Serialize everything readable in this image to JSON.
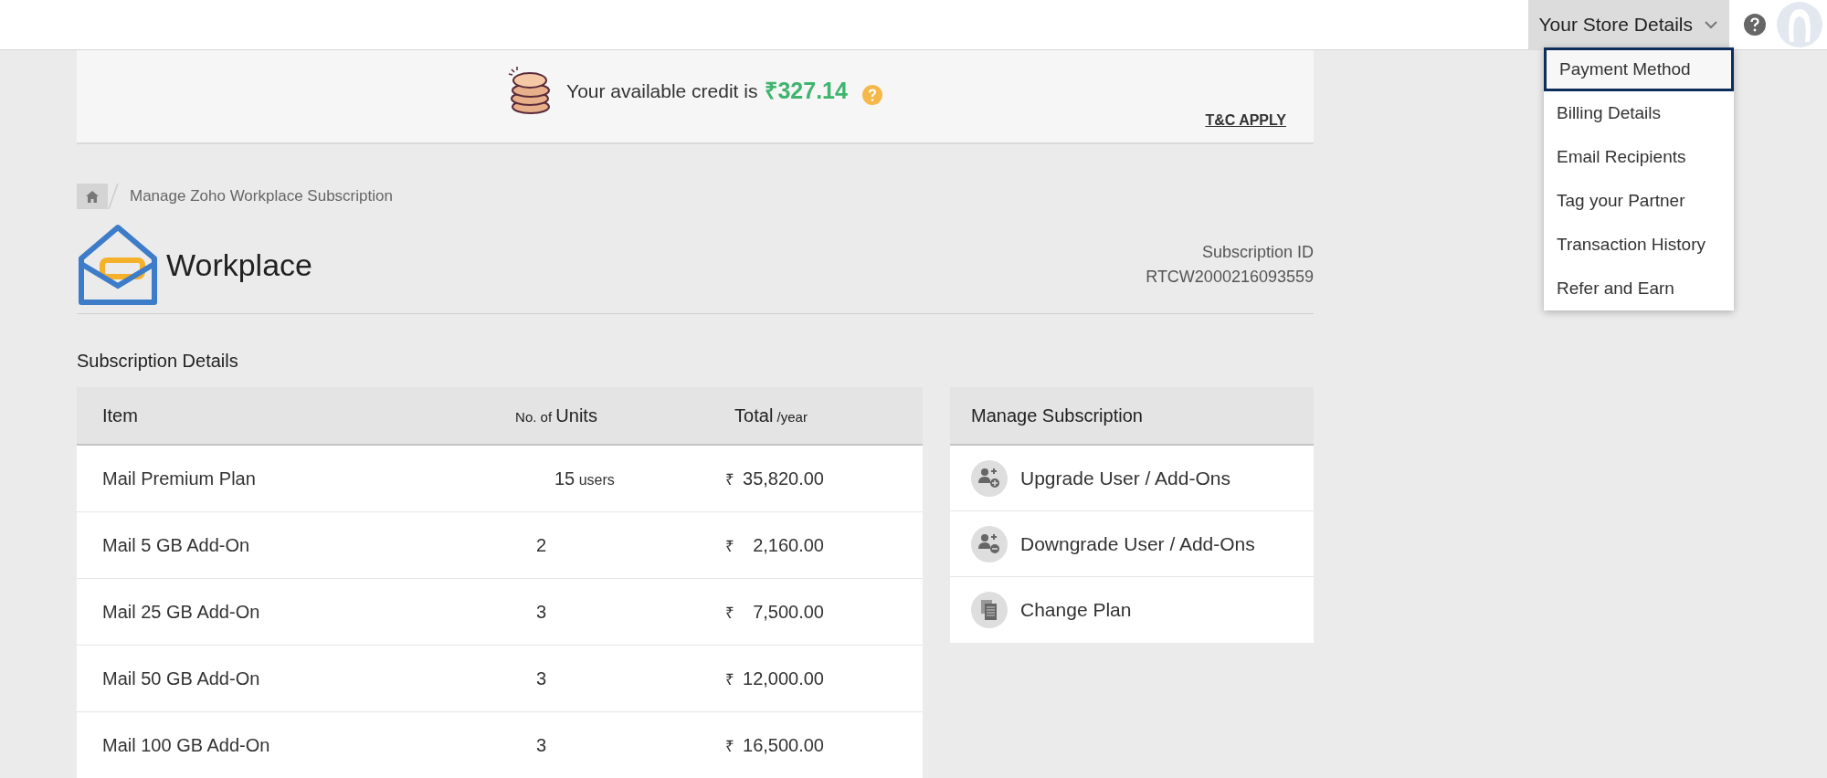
{
  "header": {
    "store_menu": {
      "label": "Your Store Details",
      "expanded": true
    },
    "store_menu_items": [
      {
        "label": "Payment Method",
        "selected": true
      },
      {
        "label": "Billing Details",
        "selected": false
      },
      {
        "label": "Email Recipients",
        "selected": false
      },
      {
        "label": "Tag your Partner",
        "selected": false
      },
      {
        "label": "Transaction History",
        "selected": false
      },
      {
        "label": "Refer and Earn",
        "selected": false
      }
    ]
  },
  "credit_banner": {
    "text": "Your available credit is",
    "amount": "₹327.14",
    "terms_link": "T&C APPLY"
  },
  "breadcrumb": {
    "current": "Manage Zoho Workplace Subscription"
  },
  "product": {
    "name": "Workplace",
    "subscription_id_label": "Subscription ID",
    "subscription_id": "RTCW2000216093559"
  },
  "section_title": "Subscription Details",
  "table": {
    "columns": [
      {
        "main": "Item"
      },
      {
        "small": "No. of",
        "main": "Units"
      },
      {
        "small": "/year",
        "main": "Total"
      }
    ],
    "rows": [
      {
        "item": "Mail Premium Plan",
        "units": "15",
        "unit_suffix": "users",
        "currency": "₹",
        "amount": "35,820.00"
      },
      {
        "item": "Mail 5 GB Add-On",
        "units": "2",
        "currency": "₹",
        "amount": "2,160.00"
      },
      {
        "item": "Mail 25 GB Add-On",
        "units": "3",
        "currency": "₹",
        "amount": "7,500.00"
      },
      {
        "item": "Mail 50 GB Add-On",
        "units": "3",
        "currency": "₹",
        "amount": "12,000.00"
      },
      {
        "item": "Mail 100 GB Add-On",
        "units": "3",
        "currency": "₹",
        "amount": "16,500.00"
      }
    ]
  },
  "manage": {
    "title": "Manage Subscription",
    "actions": [
      {
        "kind": "upgrade",
        "label": "Upgrade User / Add-Ons"
      },
      {
        "kind": "downgrade",
        "label": "Downgrade User / Add-Ons"
      },
      {
        "kind": "change_plan",
        "label": "Change Plan"
      }
    ]
  }
}
